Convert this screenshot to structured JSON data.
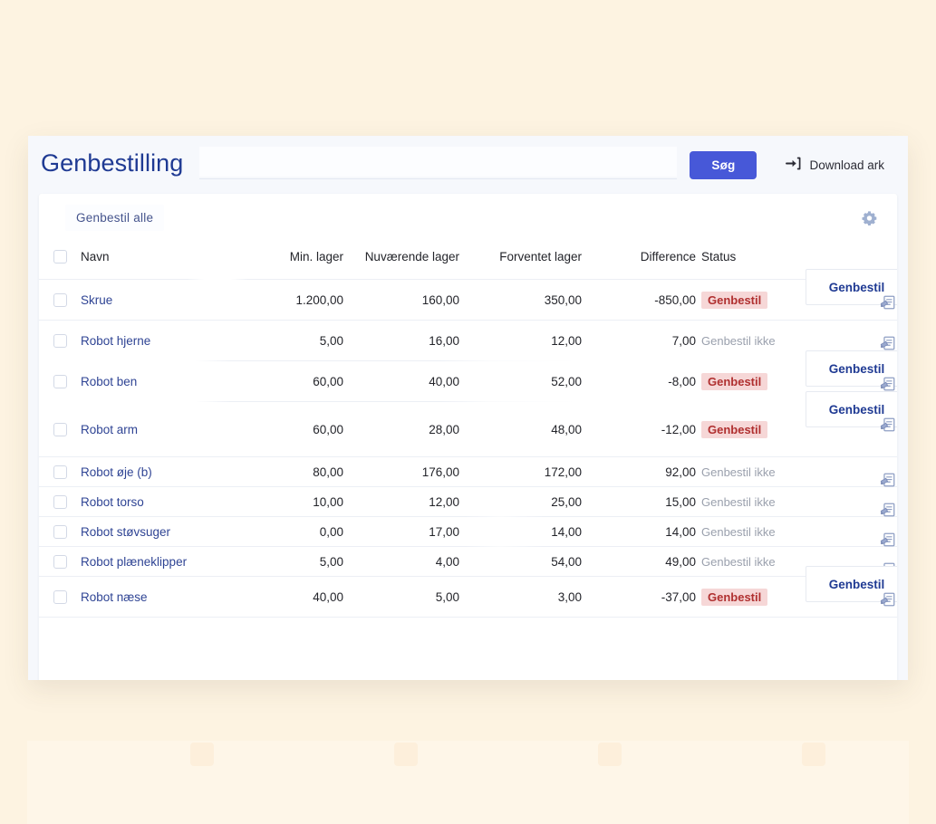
{
  "header": {
    "title": "Genbestilling",
    "search_value": "",
    "search_placeholder": "",
    "search_button_label": "Søg",
    "download_label": "Download ark"
  },
  "card": {
    "tab_label": "Genbestil alle",
    "settings_icon": "gear-icon"
  },
  "table": {
    "columns": {
      "name": "Navn",
      "min_stock": "Min. lager",
      "current_stock": "Nuværende lager",
      "expected_stock": "Forventet lager",
      "difference": "Difference",
      "status": "Status"
    },
    "action_label": "Genbestil",
    "status_reorder": "Genbestil",
    "status_no_reorder": "Genbestil ikke",
    "note_icon": "note-edit-icon",
    "rows": [
      {
        "name": "Skrue",
        "min_stock": "1.200,00",
        "current_stock": "160,00",
        "expected_stock": "350,00",
        "difference": "-850,00",
        "status": "Genbestil",
        "needs_reorder": true
      },
      {
        "name": "Robot hjerne",
        "min_stock": "5,00",
        "current_stock": "16,00",
        "expected_stock": "12,00",
        "difference": "7,00",
        "status": "Genbestil ikke",
        "needs_reorder": false
      },
      {
        "name": "Robot ben",
        "min_stock": "60,00",
        "current_stock": "40,00",
        "expected_stock": "52,00",
        "difference": "-8,00",
        "status": "Genbestil",
        "needs_reorder": true
      },
      {
        "name": "Robot arm",
        "min_stock": "60,00",
        "current_stock": "28,00",
        "expected_stock": "48,00",
        "difference": "-12,00",
        "status": "Genbestil",
        "needs_reorder": true
      },
      {
        "name": "Robot øje (b)",
        "min_stock": "80,00",
        "current_stock": "176,00",
        "expected_stock": "172,00",
        "difference": "92,00",
        "status": "Genbestil ikke",
        "needs_reorder": false
      },
      {
        "name": "Robot torso",
        "min_stock": "10,00",
        "current_stock": "12,00",
        "expected_stock": "25,00",
        "difference": "15,00",
        "status": "Genbestil ikke",
        "needs_reorder": false
      },
      {
        "name": "Robot støvsuger",
        "min_stock": "0,00",
        "current_stock": "17,00",
        "expected_stock": "14,00",
        "difference": "14,00",
        "status": "Genbestil ikke",
        "needs_reorder": false
      },
      {
        "name": "Robot plæneklipper",
        "min_stock": "5,00",
        "current_stock": "4,00",
        "expected_stock": "54,00",
        "difference": "49,00",
        "status": "Genbestil ikke",
        "needs_reorder": false
      },
      {
        "name": "Robot næse",
        "min_stock": "40,00",
        "current_stock": "5,00",
        "expected_stock": "3,00",
        "difference": "-37,00",
        "status": "Genbestil",
        "needs_reorder": true
      }
    ]
  },
  "colors": {
    "page_background": "#fdf3e1",
    "accent_blue": "#4758d8",
    "title_blue": "#1f3a93",
    "link_blue": "#2f4494",
    "badge_background": "#f6d7d7",
    "badge_text": "#b03030",
    "muted_text": "#9aa0ad"
  }
}
